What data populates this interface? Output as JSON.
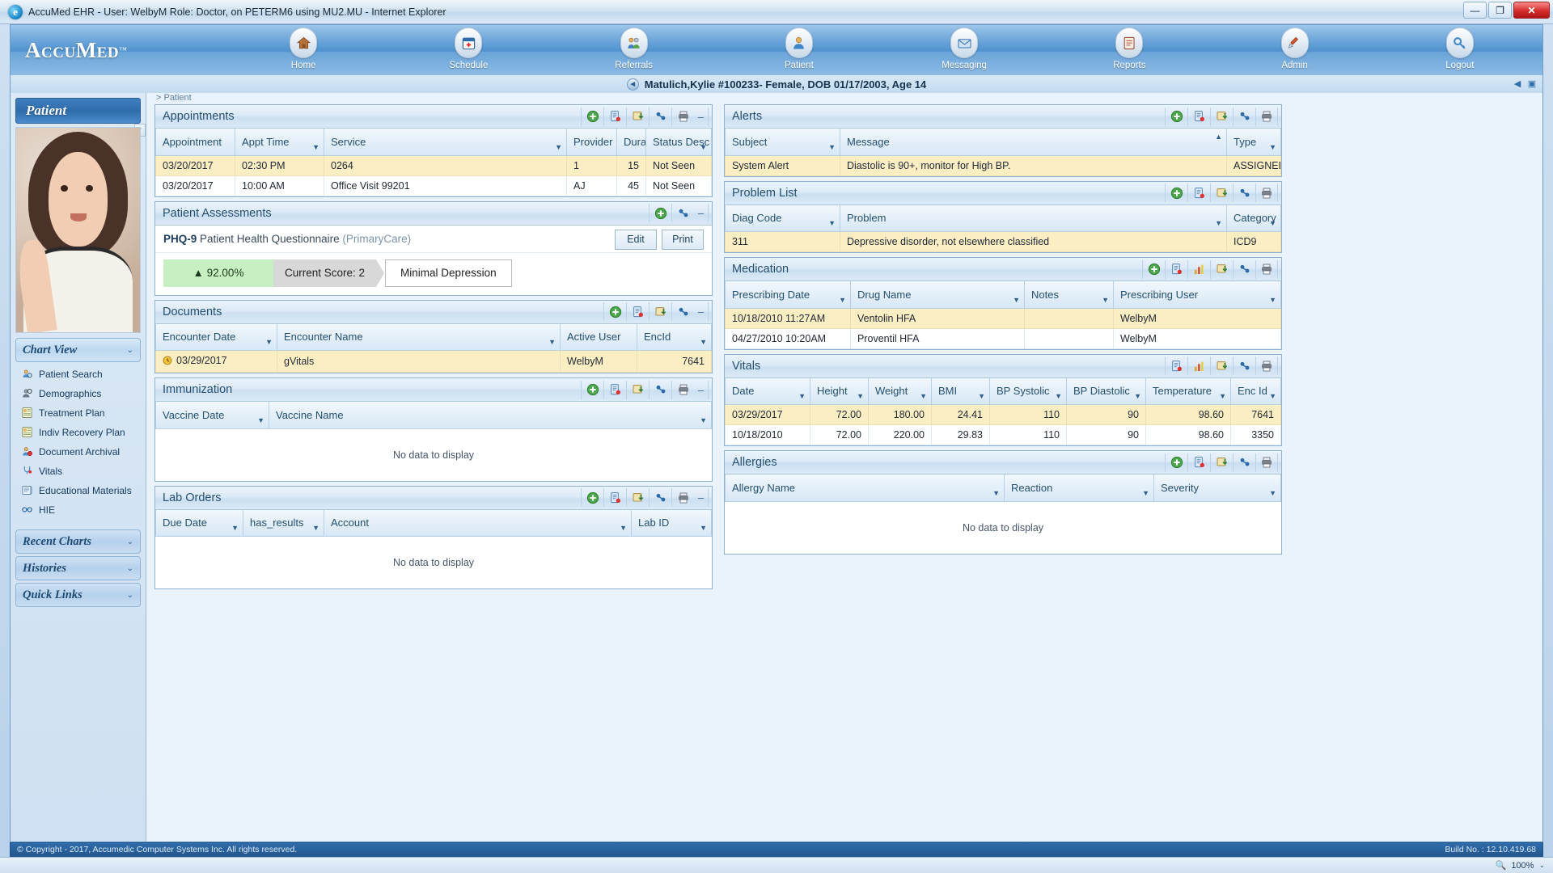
{
  "window": {
    "title": "AccuMed EHR - User: WelbyM Role: Doctor, on PETERM6 using MU2.MU - Internet Explorer",
    "browser_icon": "internet-explorer-icon",
    "minimize": "—",
    "maximize": "❐",
    "close": "✕"
  },
  "brand": {
    "name": "AccuMed",
    "tm": "™"
  },
  "nav": [
    {
      "label": "Home",
      "icon": "home-icon",
      "glyph": "🏠"
    },
    {
      "label": "Schedule",
      "icon": "calendar-icon",
      "glyph": "📅"
    },
    {
      "label": "Referrals",
      "icon": "referrals-icon",
      "glyph": "👥"
    },
    {
      "label": "Patient",
      "icon": "patient-icon",
      "glyph": "👤"
    },
    {
      "label": "Messaging",
      "icon": "messaging-icon",
      "glyph": "✉"
    },
    {
      "label": "Reports",
      "icon": "reports-icon",
      "glyph": "📊"
    },
    {
      "label": "Admin",
      "icon": "admin-icon",
      "glyph": "🔧"
    },
    {
      "label": "Logout",
      "icon": "logout-icon",
      "glyph": "🔑"
    }
  ],
  "patient_header": {
    "back_glyph": "◄",
    "name": "Matulich,Kylie #100233- Female, DOB 01/17/2003, Age 14",
    "breadcrumb": "> Patient"
  },
  "sidebar": {
    "banner": "Patient",
    "groups": {
      "chart_view": "Chart View",
      "recent_charts": "Recent Charts",
      "histories": "Histories",
      "quick_links": "Quick Links"
    },
    "links": [
      {
        "label": "Patient Search",
        "icon": "patient-search-icon",
        "glyph": "🔍"
      },
      {
        "label": "Demographics",
        "icon": "demographics-icon",
        "glyph": "👤"
      },
      {
        "label": "Treatment Plan",
        "icon": "treatment-plan-icon",
        "glyph": "📋"
      },
      {
        "label": "Indiv Recovery Plan",
        "icon": "recovery-plan-icon",
        "glyph": "📋"
      },
      {
        "label": "Document Archival",
        "icon": "document-archival-icon",
        "glyph": "🗂"
      },
      {
        "label": "Vitals",
        "icon": "vitals-icon",
        "glyph": "🩺"
      },
      {
        "label": "Educational Materials",
        "icon": "education-icon",
        "glyph": "📖"
      },
      {
        "label": "HIE",
        "icon": "hie-icon",
        "glyph": "🔗"
      }
    ],
    "chevron": "⌄",
    "scroll_up": "⌃"
  },
  "tool_icons": {
    "add": "➕",
    "document": "📄",
    "export": "💾",
    "link": "🔗",
    "print": "🖨",
    "chart": "📊",
    "collapse": "–"
  },
  "panels": {
    "appointments": {
      "title": "Appointments",
      "tools": [
        "add",
        "document",
        "export",
        "link",
        "print",
        "collapse"
      ],
      "columns": [
        "Appointment",
        "Appt Time",
        "Service",
        "Provider",
        "Dura",
        "Status Desc"
      ],
      "rows": [
        {
          "cells": [
            "03/20/2017",
            "02:30 PM",
            "0264",
            "1",
            "15",
            "Not Seen"
          ],
          "highlight": true
        },
        {
          "cells": [
            "03/20/2017",
            "10:00 AM",
            "Office Visit 99201",
            "AJ",
            "45",
            "Not Seen"
          ],
          "highlight": false
        }
      ]
    },
    "patient_assessments": {
      "title": "Patient Assessments",
      "tools": [
        "add",
        "link",
        "collapse"
      ],
      "assessment_code": "PHQ-9",
      "assessment_name": "Patient Health Questionnaire",
      "assessment_context": "(PrimaryCare)",
      "edit_label": "Edit",
      "print_label": "Print",
      "percent": "▲ 92.00%",
      "current_score": "Current Score: 2",
      "severity": "Minimal Depression"
    },
    "documents": {
      "title": "Documents",
      "tools": [
        "add",
        "document",
        "export",
        "link",
        "collapse"
      ],
      "columns": [
        "Encounter Date",
        "Encounter Name",
        "Active User",
        "EncId"
      ],
      "rows": [
        {
          "cells": [
            "03/29/2017",
            "gVitals",
            "WelbyM",
            "7641"
          ],
          "highlight": true,
          "status_icon": "clock-icon"
        }
      ]
    },
    "immunization": {
      "title": "Immunization",
      "tools": [
        "add",
        "document",
        "export",
        "link",
        "print",
        "collapse"
      ],
      "columns": [
        "Vaccine Date",
        "Vaccine Name"
      ],
      "empty_text": "No data to display"
    },
    "lab_orders": {
      "title": "Lab Orders",
      "tools": [
        "add",
        "document",
        "export",
        "link",
        "print",
        "collapse"
      ],
      "columns": [
        "Due Date",
        "has_results",
        "Account",
        "Lab ID"
      ],
      "empty_text": "No data to display"
    },
    "alerts": {
      "title": "Alerts",
      "tools": [
        "add",
        "document",
        "export",
        "link",
        "print"
      ],
      "columns": [
        "Subject",
        "Message",
        "Type"
      ],
      "rows": [
        {
          "cells": [
            "System Alert",
            "Diastolic is 90+, monitor for High BP.",
            "ASSIGNED"
          ],
          "highlight": true
        }
      ]
    },
    "problem_list": {
      "title": "Problem List",
      "tools": [
        "add",
        "document",
        "export",
        "link",
        "print"
      ],
      "columns": [
        "Diag Code",
        "Problem",
        "Category"
      ],
      "rows": [
        {
          "cells": [
            "311",
            "Depressive disorder, not elsewhere classified",
            "ICD9"
          ],
          "highlight": true
        }
      ]
    },
    "medication": {
      "title": "Medication",
      "tools": [
        "add",
        "document",
        "chart",
        "export",
        "link",
        "print"
      ],
      "columns": [
        "Prescribing Date",
        "Drug Name",
        "Notes",
        "Prescribing User"
      ],
      "rows": [
        {
          "cells": [
            "10/18/2010 11:27AM",
            "Ventolin HFA",
            "",
            "WelbyM"
          ],
          "highlight": true
        },
        {
          "cells": [
            "04/27/2010 10:20AM",
            "Proventil HFA",
            "",
            "WelbyM"
          ],
          "highlight": false
        }
      ]
    },
    "vitals": {
      "title": "Vitals",
      "tools": [
        "document",
        "chart",
        "export",
        "link",
        "print"
      ],
      "columns": [
        "Date",
        "Height",
        "Weight",
        "BMI",
        "BP Systolic",
        "BP Diastolic",
        "Temperature",
        "Enc Id"
      ],
      "rows": [
        {
          "cells": [
            "03/29/2017",
            "72.00",
            "180.00",
            "24.41",
            "110",
            "90",
            "98.60",
            "7641"
          ],
          "highlight": true
        },
        {
          "cells": [
            "10/18/2010",
            "72.00",
            "220.00",
            "29.83",
            "110",
            "90",
            "98.60",
            "3350"
          ],
          "highlight": false
        }
      ]
    },
    "allergies": {
      "title": "Allergies",
      "tools": [
        "add",
        "document",
        "export",
        "link",
        "print"
      ],
      "columns": [
        "Allergy Name",
        "Reaction",
        "Severity"
      ],
      "empty_text": "No data to display"
    }
  },
  "footer": {
    "copyright": "© Copyright - 2017, Accumedic Computer Systems Inc. All rights reserved.",
    "build": "Build No. : 12.10.419.68"
  },
  "statusbar": {
    "zoom_icon": "magnifier-icon",
    "zoom": "100%",
    "chevron": "⌄"
  }
}
